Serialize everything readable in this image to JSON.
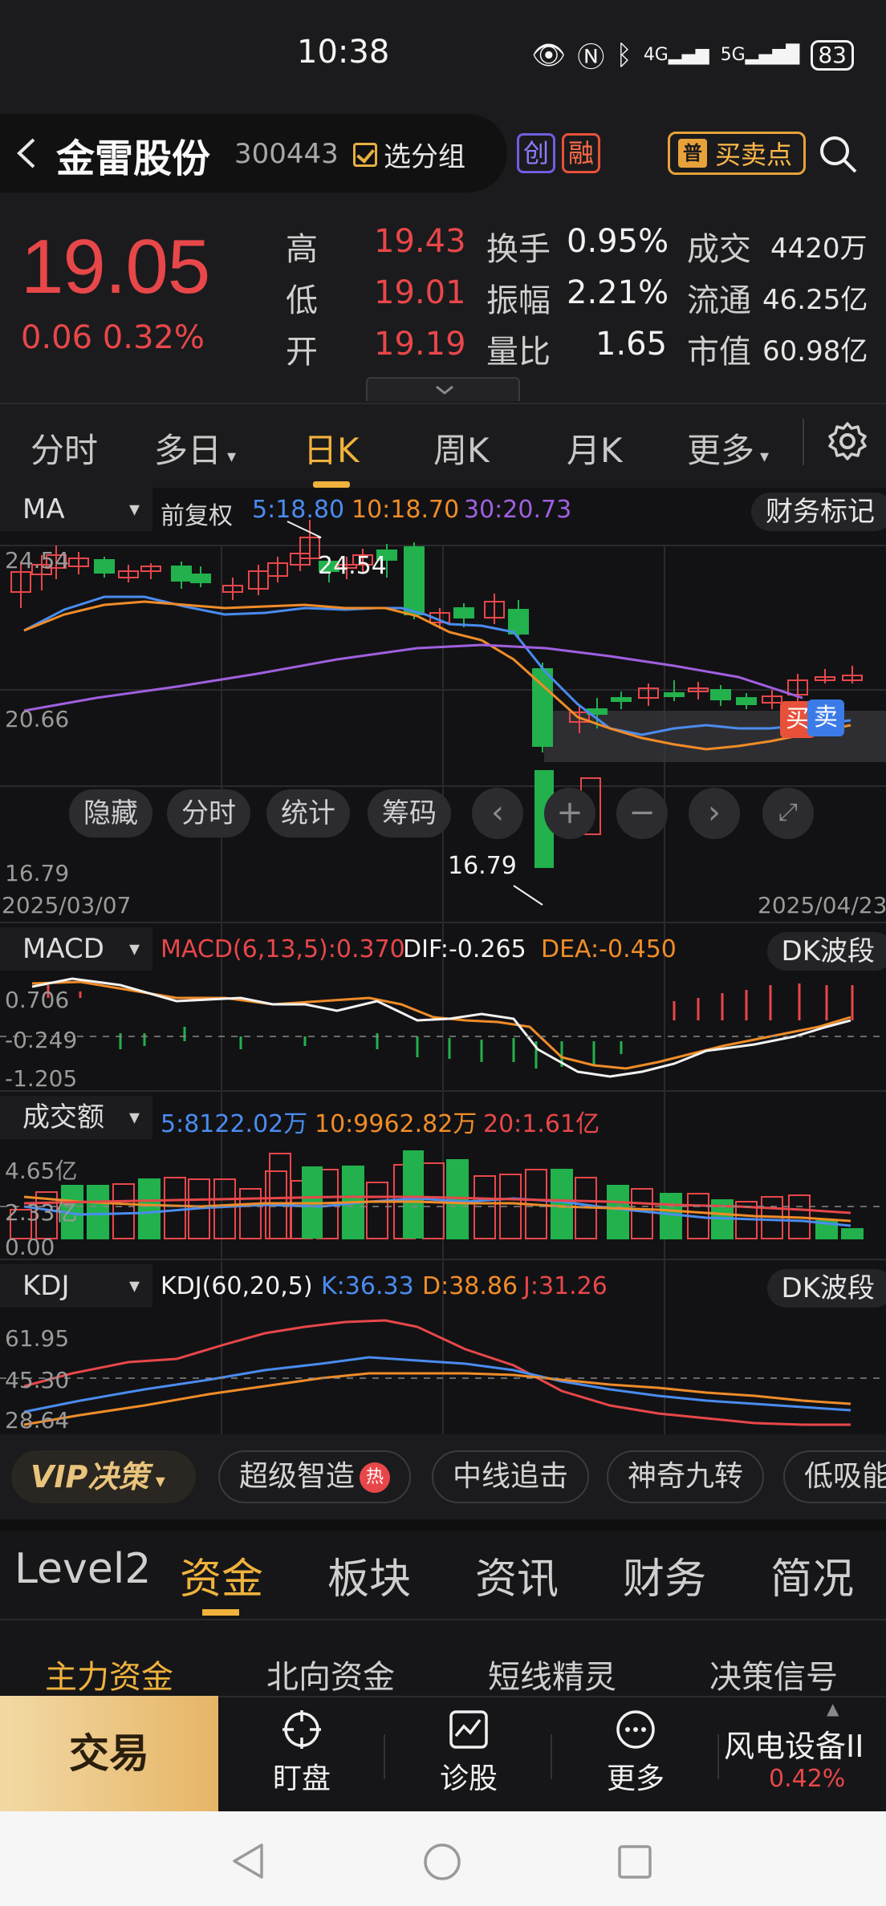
{
  "status": {
    "time": "10:38",
    "battery": "83",
    "net1": "4G",
    "net2": "5G"
  },
  "header": {
    "stock_name": "金雷股份",
    "stock_code": "300443",
    "group_label": "选分组",
    "tag1": "创",
    "tag2": "融",
    "buysell_badge": "普",
    "buysell_label": "买卖点"
  },
  "quote": {
    "price": "19.05",
    "change": "0.06 0.32%",
    "high_label": "高",
    "high": "19.43",
    "low_label": "低",
    "low": "19.01",
    "open_label": "开",
    "open": "19.19",
    "turnover_label": "换手",
    "turnover": "0.95%",
    "amplitude_label": "振幅",
    "amplitude": "2.21%",
    "volratio_label": "量比",
    "volratio": "1.65",
    "deal_label": "成交",
    "deal": "4420万",
    "float_label": "流通",
    "float": "46.25亿",
    "mktcap_label": "市值",
    "mktcap": "60.98亿"
  },
  "period_tabs": [
    "分时",
    "多日",
    "日K",
    "周K",
    "月K",
    "更多"
  ],
  "main_chart": {
    "indicator": "MA",
    "adjust": "前复权",
    "ma5": "5:18.80",
    "ma10": "10:18.70",
    "ma30": "30:20.73",
    "finance_btn": "财务标记",
    "y_high": "24.54",
    "y_mid": "20.66",
    "y_low": "16.79",
    "max_label": "24.54",
    "min_label": "16.79",
    "date_start": "2025/03/07",
    "date_end": "2025/04/23",
    "buy_marker": "买",
    "sell_marker": "卖",
    "controls": [
      "隐藏",
      "分时",
      "统计",
      "筹码"
    ]
  },
  "macd": {
    "indicator": "MACD",
    "params": "MACD(6,13,5):0.370",
    "dif": "DIF:-0.265",
    "dea": "DEA:-0.450",
    "right_btn": "DK波段",
    "y1": "0.706",
    "y2": "-0.249",
    "y3": "-1.205"
  },
  "volume": {
    "indicator": "成交额",
    "ma5": "5:8122.02万",
    "ma10": "10:9962.82万",
    "ma20": "20:1.61亿",
    "y1": "4.65亿",
    "y2": "2.33亿",
    "y3": "0.00"
  },
  "kdj": {
    "indicator": "KDJ",
    "params": "KDJ(60,20,5)",
    "k": "K:36.33",
    "d": "D:38.86",
    "j": "J:31.26",
    "right_btn": "DK波段",
    "y1": "61.95",
    "y2": "45.30",
    "y3": "28.64"
  },
  "strategies": {
    "vip": "VIP决策",
    "items": [
      "超级智造",
      "中线追击",
      "神奇九转",
      "低吸能"
    ],
    "hot": "热"
  },
  "info_tabs": [
    "Level2",
    "资金",
    "板块",
    "资讯",
    "财务",
    "简况"
  ],
  "sub_tabs": [
    "主力资金",
    "北向资金",
    "短线精灵",
    "决策信号"
  ],
  "actions": {
    "trade": "交易",
    "watch": "盯盘",
    "diagnose": "诊股",
    "more": "更多",
    "sector": "风电设备II",
    "sector_change": "0.42%"
  },
  "colors": {
    "up": "#e8474a",
    "down": "#22b14c",
    "accent": "#f0b23c",
    "ma5": "#4a8cf0",
    "ma10": "#f08c28",
    "ma30": "#a060e0"
  }
}
